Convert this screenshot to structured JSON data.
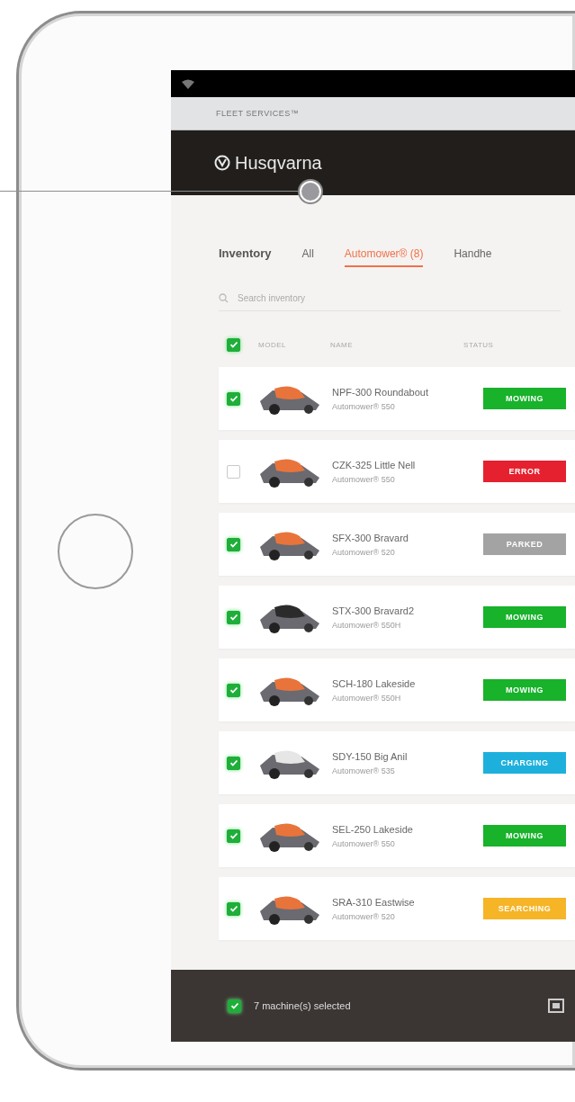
{
  "browser_bar": {
    "title": "FLEET SERVICES™"
  },
  "header": {
    "logo": "Husqvarna"
  },
  "tabs": [
    {
      "label": "Inventory",
      "kind": "title",
      "selected": false
    },
    {
      "label": "All",
      "kind": "tab",
      "selected": false
    },
    {
      "label": "Automower® (8)",
      "kind": "tab",
      "selected": true
    },
    {
      "label": "Handhe",
      "kind": "tab",
      "selected": false
    }
  ],
  "search": {
    "placeholder": "Search inventory"
  },
  "table": {
    "select_all": {
      "checked": true
    },
    "columns": [
      "MODEL",
      "NAME",
      "STATUS"
    ],
    "rows": [
      {
        "checked": true,
        "color": "#e8743c",
        "name": "NPF-300 Roundabout",
        "model": "Automower® 550",
        "status": "MOWING",
        "kind": "mowing"
      },
      {
        "checked": false,
        "color": "#e8743c",
        "name": "CZK-325 Little Nell",
        "model": "Automower® 550",
        "status": "ERROR",
        "kind": "error"
      },
      {
        "checked": true,
        "color": "#e8743c",
        "name": "SFX-300 Bravard",
        "model": "Automower® 520",
        "status": "PARKED",
        "kind": "parked"
      },
      {
        "checked": true,
        "color": "#2b2b2b",
        "name": "STX-300 Bravard2",
        "model": "Automower® 550H",
        "status": "MOWING",
        "kind": "mowing"
      },
      {
        "checked": true,
        "color": "#e8743c",
        "name": "SCH-180 Lakeside",
        "model": "Automower® 550H",
        "status": "MOWING",
        "kind": "mowing"
      },
      {
        "checked": true,
        "color": "#e6e6e6",
        "name": "SDY-150 Big Anil",
        "model": "Automower® 535",
        "status": "CHARGING",
        "kind": "charging"
      },
      {
        "checked": true,
        "color": "#e8743c",
        "name": "SEL-250 Lakeside",
        "model": "Automower® 550",
        "status": "MOWING",
        "kind": "mowing"
      },
      {
        "checked": true,
        "color": "#e8743c",
        "name": "SRA-310 Eastwise",
        "model": "Automower® 520",
        "status": "SEARCHING",
        "kind": "searching"
      }
    ]
  },
  "bottom_bar": {
    "checked": true,
    "text": "7 machine(s) selected"
  }
}
